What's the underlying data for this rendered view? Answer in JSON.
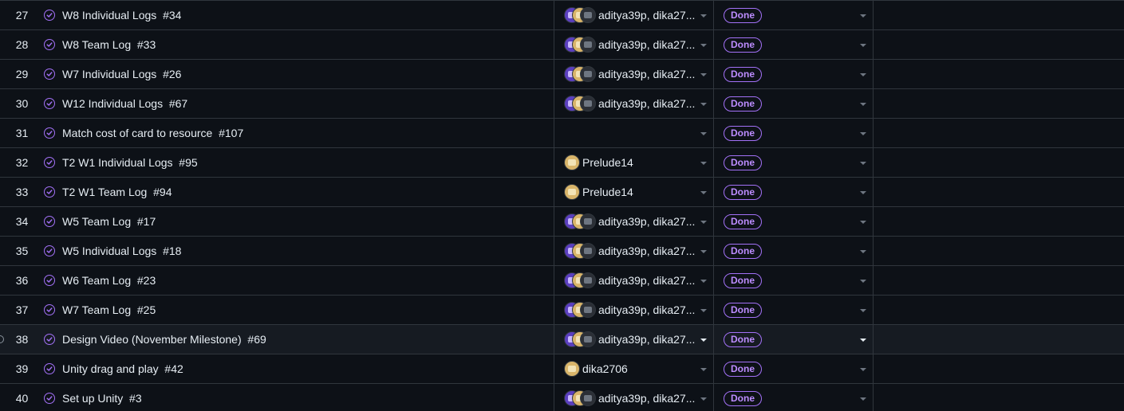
{
  "colors": {
    "background": "#0d1117",
    "border": "#30363d",
    "done_purple": "#a371f7",
    "highlight_row": "#161b22"
  },
  "rows": [
    {
      "num": "27",
      "title": "W8 Individual Logs  #34",
      "assignees": "aditya39p, dika27...",
      "avatars": [
        "purple",
        "gold",
        "dark"
      ],
      "status": "Done",
      "highlight": false
    },
    {
      "num": "28",
      "title": "W8 Team Log  #33",
      "assignees": "aditya39p, dika27...",
      "avatars": [
        "purple",
        "gold",
        "dark"
      ],
      "status": "Done",
      "highlight": false
    },
    {
      "num": "29",
      "title": "W7 Individual Logs  #26",
      "assignees": "aditya39p, dika27...",
      "avatars": [
        "purple",
        "gold",
        "dark"
      ],
      "status": "Done",
      "highlight": false
    },
    {
      "num": "30",
      "title": "W12 Individual Logs  #67",
      "assignees": "aditya39p, dika27...",
      "avatars": [
        "purple",
        "gold",
        "dark"
      ],
      "status": "Done",
      "highlight": false
    },
    {
      "num": "31",
      "title": "Match cost of card to resource  #107",
      "assignees": "",
      "avatars": [],
      "status": "Done",
      "highlight": false
    },
    {
      "num": "32",
      "title": "T2 W1 Individual Logs  #95",
      "assignees": "Prelude14",
      "avatars": [
        "gold"
      ],
      "status": "Done",
      "highlight": false
    },
    {
      "num": "33",
      "title": "T2 W1 Team Log  #94",
      "assignees": "Prelude14",
      "avatars": [
        "gold"
      ],
      "status": "Done",
      "highlight": false
    },
    {
      "num": "34",
      "title": "W5 Team Log  #17",
      "assignees": "aditya39p, dika27...",
      "avatars": [
        "purple",
        "gold",
        "dark"
      ],
      "status": "Done",
      "highlight": false
    },
    {
      "num": "35",
      "title": "W5 Individual Logs  #18",
      "assignees": "aditya39p, dika27...",
      "avatars": [
        "purple",
        "gold",
        "dark"
      ],
      "status": "Done",
      "highlight": false
    },
    {
      "num": "36",
      "title": "W6 Team Log  #23",
      "assignees": "aditya39p, dika27...",
      "avatars": [
        "purple",
        "gold",
        "dark"
      ],
      "status": "Done",
      "highlight": false
    },
    {
      "num": "37",
      "title": "W7 Team Log  #25",
      "assignees": "aditya39p, dika27...",
      "avatars": [
        "purple",
        "gold",
        "dark"
      ],
      "status": "Done",
      "highlight": false
    },
    {
      "num": "38",
      "title": "Design Video (November Milestone)  #69",
      "assignees": "aditya39p, dika27...",
      "avatars": [
        "purple",
        "gold",
        "dark"
      ],
      "status": "Done",
      "highlight": true
    },
    {
      "num": "39",
      "title": "Unity drag and play  #42",
      "assignees": "dika2706",
      "avatars": [
        "gold"
      ],
      "status": "Done",
      "highlight": false
    },
    {
      "num": "40",
      "title": "Set up Unity  #3",
      "assignees": "aditya39p, dika27...",
      "avatars": [
        "purple",
        "gold",
        "dark"
      ],
      "status": "Done",
      "highlight": false
    }
  ]
}
